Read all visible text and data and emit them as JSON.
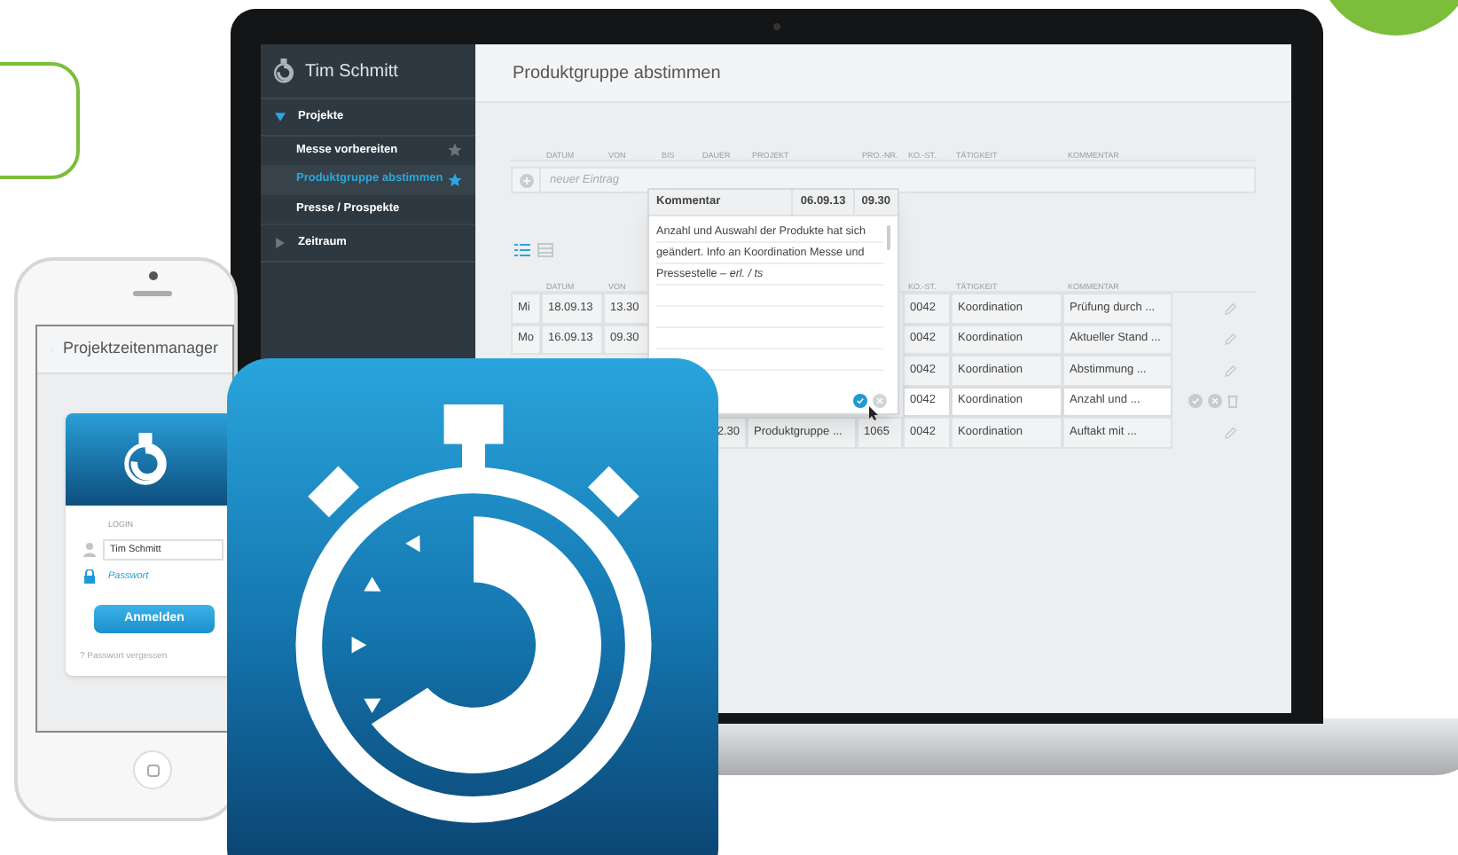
{
  "laptop": {
    "sidebar": {
      "user": "Tim Schmitt",
      "groups": [
        {
          "label": "Projekte",
          "expanded": true,
          "children": [
            {
              "label": "Messe vorbereiten",
              "selected": false,
              "favorite": true
            },
            {
              "label": "Produktgruppe abstimmen",
              "selected": true,
              "favorite": true
            },
            {
              "label": "Presse / Prospekte",
              "selected": false,
              "favorite": false
            }
          ]
        },
        {
          "label": "Zeitraum",
          "expanded": false
        }
      ]
    },
    "main": {
      "title": "Produktgruppe abstimmen",
      "entry_header": {
        "datum": "DATUM",
        "von": "VON",
        "bis": "BIS",
        "dauer": "DAUER",
        "projekt": "PROJEKT",
        "pro_nr": "PRO.-NR.",
        "ko_st": "KO.-ST.",
        "taetigkeit": "TÄTIGKEIT",
        "kommentar": "KOMMENTAR"
      },
      "new_entry": {
        "placeholder": "neuer Eintrag"
      },
      "views": [
        {
          "kind": "list",
          "selected": true
        },
        {
          "kind": "grid",
          "selected": false
        }
      ],
      "list_header": {
        "datum": "DATUM",
        "von": "VON",
        "ko_st": "KO.-ST.",
        "taetigkeit": "TÄTIGKEIT",
        "kommentar": "KOMMENTAR"
      },
      "rows": [
        {
          "day": "Mi",
          "datum": "18.09.13",
          "von": "13.30",
          "ko_st": "0042",
          "taetigkeit": "Koordination",
          "kommentar": "Prüfung durch ...",
          "editing": false
        },
        {
          "day": "Mo",
          "datum": "16.09.13",
          "von": "09.30",
          "ko_st": "0042",
          "taetigkeit": "Koordination",
          "kommentar": "Aktueller Stand ...",
          "editing": false
        },
        {
          "ko_st": "0042",
          "taetigkeit": "Koordination",
          "kommentar": "Abstimmung ...",
          "editing": false
        },
        {
          "ko_st": "0042",
          "taetigkeit": "Koordination",
          "kommentar": "Anzahl und ...",
          "editing": true
        },
        {
          "dauer": "2.30",
          "projekt": "Produktgruppe ...",
          "pro_nr": "1065",
          "ko_st": "0042",
          "taetigkeit": "Koordination",
          "kommentar": "Auftakt mit ...",
          "editing": false
        }
      ],
      "comment_popup": {
        "title": "Kommentar",
        "date": "06.09.13",
        "time": "09.30",
        "lines": [
          "Anzahl und Auswahl der Produkte hat sich",
          "geändert. Info an Koordination Messe und",
          "Pressestelle – *erl. / ts*"
        ]
      }
    }
  },
  "phone": {
    "title": "Projektzeitenmanager",
    "login": {
      "label": "LOGIN",
      "username": "Tim Schmitt",
      "password_placeholder": "Passwort",
      "button": "Anmelden",
      "forgot": "? Passwort vergessen"
    }
  }
}
